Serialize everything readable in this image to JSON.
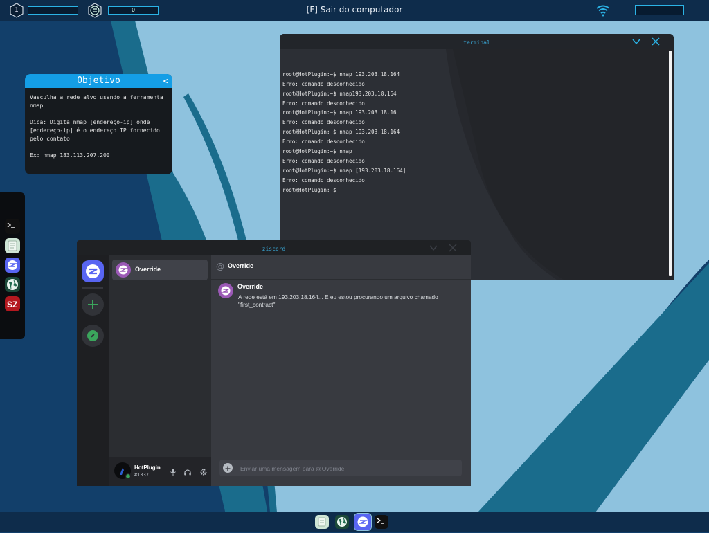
{
  "topbar": {
    "workspace_number": "1",
    "currency_value": "0",
    "exit_label": "[F] Sair do computador",
    "icons": [
      "workspace-hex-icon",
      "crypto-coin-icon",
      "wifi-icon"
    ],
    "accent": "#2bb3e6"
  },
  "objective": {
    "title": "Objetivo",
    "collapse_label": "<",
    "paragraphs": [
      "Vasculha a rede alvo usando a ferramenta nmap",
      "Dica: Digita nmap [endereço-ip] onde [endereço-ip] é o endereço IP fornecido pelo contato",
      "Ex: nmap 183.113.207.200"
    ],
    "accent": "#149ee6"
  },
  "left_dock": {
    "items": [
      "terminal-icon",
      "notes-icon",
      "ziscord-icon",
      "browser-globe-icon",
      "sz-app-icon"
    ]
  },
  "terminal": {
    "title": "terminal",
    "lines": [
      "root@HotPlugin:~$ nmap 193.203.18.164",
      "Erro: comando desconhecido",
      "root@HotPlugin:~$ nmap193.203.18.164",
      "Erro: comando desconhecido",
      "root@HotPlugin:~$ nmap 193.203.18.16",
      "Erro: comando desconhecido",
      "root@HotPlugin:~$ nmap 193.203.18.164",
      "Erro: comando desconhecido",
      "root@HotPlugin:~$ nmap",
      "Erro: comando desconhecido",
      "root@HotPlugin:~$ nmap [193.203.18.164]",
      "Erro: comando desconhecido",
      "root@HotPlugin:~$"
    ]
  },
  "ziscord": {
    "title": "ziscord",
    "dm": {
      "name": "Override"
    },
    "header": {
      "at": "@",
      "name": "Override"
    },
    "message": {
      "author": "Override",
      "text": "A rede está em 193.203.18.164... E eu estou procurando um arquivo chamado \"first_contract\""
    },
    "input_placeholder": "Enviar uma mensagem para @Override",
    "user": {
      "name": "HotPlugin",
      "tag": "#1337"
    },
    "colors": {
      "brand": "#5865f2",
      "override_avatar": "#9b59b6",
      "green": "#3ba55c"
    }
  },
  "taskbar": {
    "items": [
      "notes-icon",
      "browser-globe-icon",
      "ziscord-icon",
      "terminal-icon"
    ]
  }
}
